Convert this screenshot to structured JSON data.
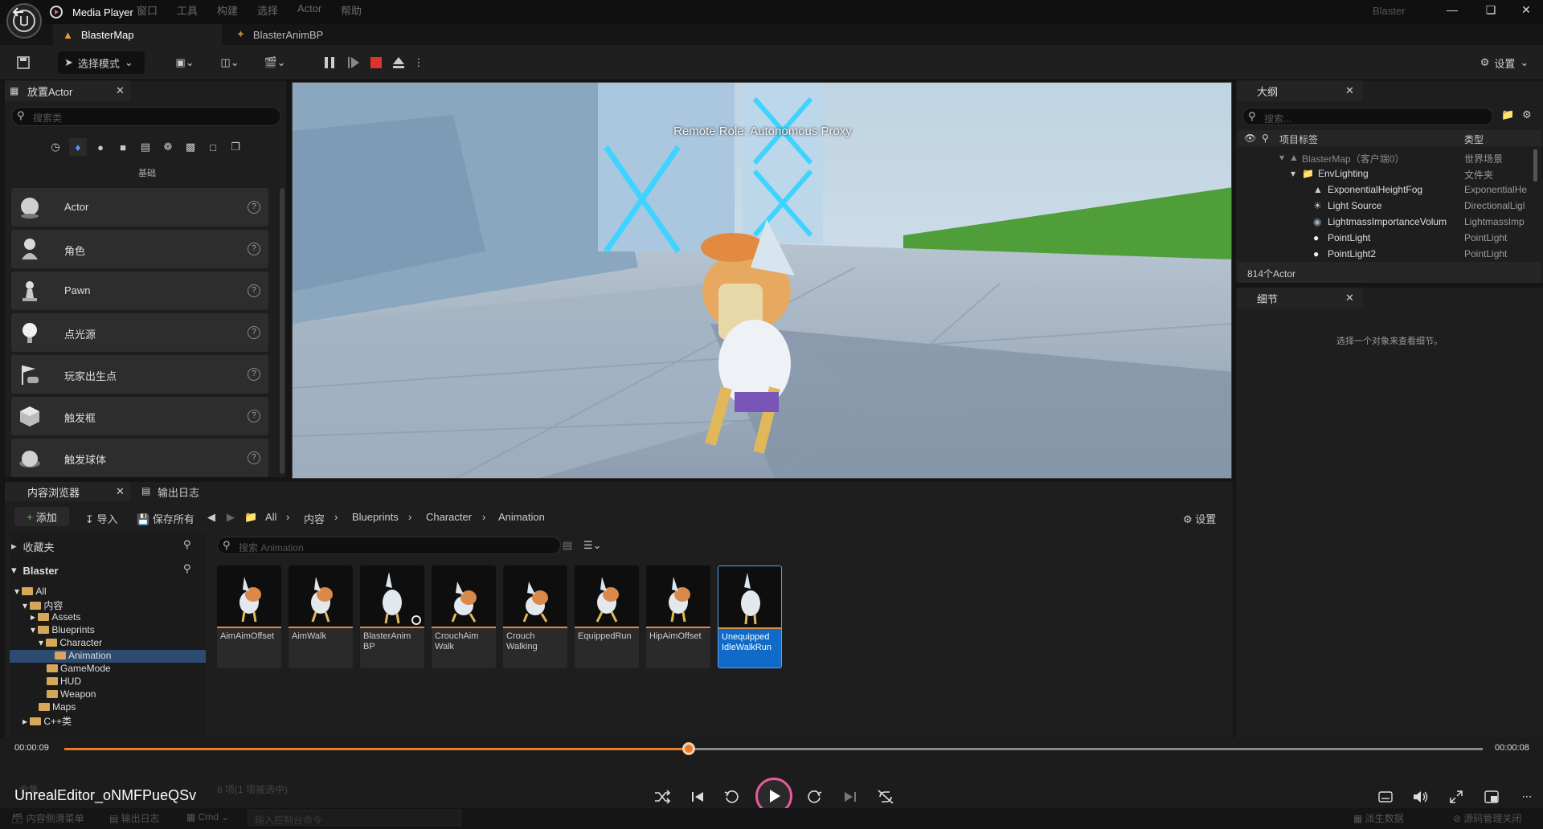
{
  "titlebar": {
    "app_title": "Media Player",
    "menus": [
      "窗口",
      "工具",
      "构建",
      "选择",
      "Actor",
      "帮助"
    ],
    "window_title": "Blaster"
  },
  "tabs": {
    "map": "BlasterMap",
    "anim": "BlasterAnimBP"
  },
  "toolbar": {
    "select_mode": "选择模式",
    "settings": "设置"
  },
  "place_actors": {
    "tab_title": "放置Actor",
    "search_placeholder": "搜索类",
    "category": "基础",
    "items": [
      {
        "label": "Actor",
        "icon": "sphere-icon"
      },
      {
        "label": "角色",
        "icon": "character-icon"
      },
      {
        "label": "Pawn",
        "icon": "pawn-icon"
      },
      {
        "label": "点光源",
        "icon": "point-light-icon"
      },
      {
        "label": "玩家出生点",
        "icon": "player-start-icon"
      },
      {
        "label": "触发框",
        "icon": "trigger-box-icon"
      },
      {
        "label": "触发球体",
        "icon": "trigger-sphere-icon"
      }
    ]
  },
  "viewport": {
    "overlay_text": "Remote Role: Autonomous Proxy"
  },
  "outliner": {
    "tab_title": "大纲",
    "search_placeholder": "搜索...",
    "col_label": "项目标签",
    "col_type": "类型",
    "rows": [
      {
        "label": "BlasterMap（客户端0）",
        "type": "世界场景"
      },
      {
        "label": "EnvLighting",
        "type": "文件夹"
      },
      {
        "label": "ExponentialHeightFog",
        "type": "ExponentialHe"
      },
      {
        "label": "Light Source",
        "type": "DirectionalLigl"
      },
      {
        "label": "LightmassImportanceVolum",
        "type": "LightmassImp"
      },
      {
        "label": "PointLight",
        "type": "PointLight"
      },
      {
        "label": "PointLight2",
        "type": "PointLight"
      }
    ],
    "actor_count": "814个Actor"
  },
  "details": {
    "tab_title": "细节",
    "hint": "选择一个对象来查看细节。"
  },
  "content_browser": {
    "tab_title": "内容浏览器",
    "log_tab": "输出日志",
    "add": "添加",
    "import": "导入",
    "save_all": "保存所有",
    "breadcrumb": [
      "All",
      "内容",
      "Blueprints",
      "Character",
      "Animation"
    ],
    "settings": "设置",
    "favorites": "收藏夹",
    "root": "Blaster",
    "search_placeholder": "搜索 Animation",
    "folders": [
      "All",
      "内容",
      "Assets",
      "Blueprints",
      "Character",
      "Animation",
      "GameMode",
      "HUD",
      "Weapon",
      "Maps",
      "C++类"
    ],
    "assets": [
      {
        "name": "AimAimOffset"
      },
      {
        "name": "AimWalk"
      },
      {
        "name": "BlasterAnim BP"
      },
      {
        "name": "CrouchAim Walk"
      },
      {
        "name": "Crouch Walking"
      },
      {
        "name": "EquippedRun"
      },
      {
        "name": "HipAimOffset"
      },
      {
        "name": "Unequipped IdleWalkRun"
      }
    ],
    "selection_status": "8 项(1 项被选中)",
    "collections": "合集"
  },
  "media_player": {
    "current_time": "00:00:09",
    "total_time": "00:00:08",
    "progress": 0.44,
    "file_name": "UnrealEditor_oNMFPueQSv"
  },
  "statusbar": {
    "drawer": "内容侧滑菜单",
    "log": "输出日志",
    "cmd": "Cmd",
    "console_placeholder": "输入控制台命令",
    "derived": "派生数据",
    "source_control": "源码管理关闭"
  },
  "colors": {
    "accent": "#e87b2e",
    "selection": "#0f6ac8",
    "play_ring": "#e65aa0"
  }
}
